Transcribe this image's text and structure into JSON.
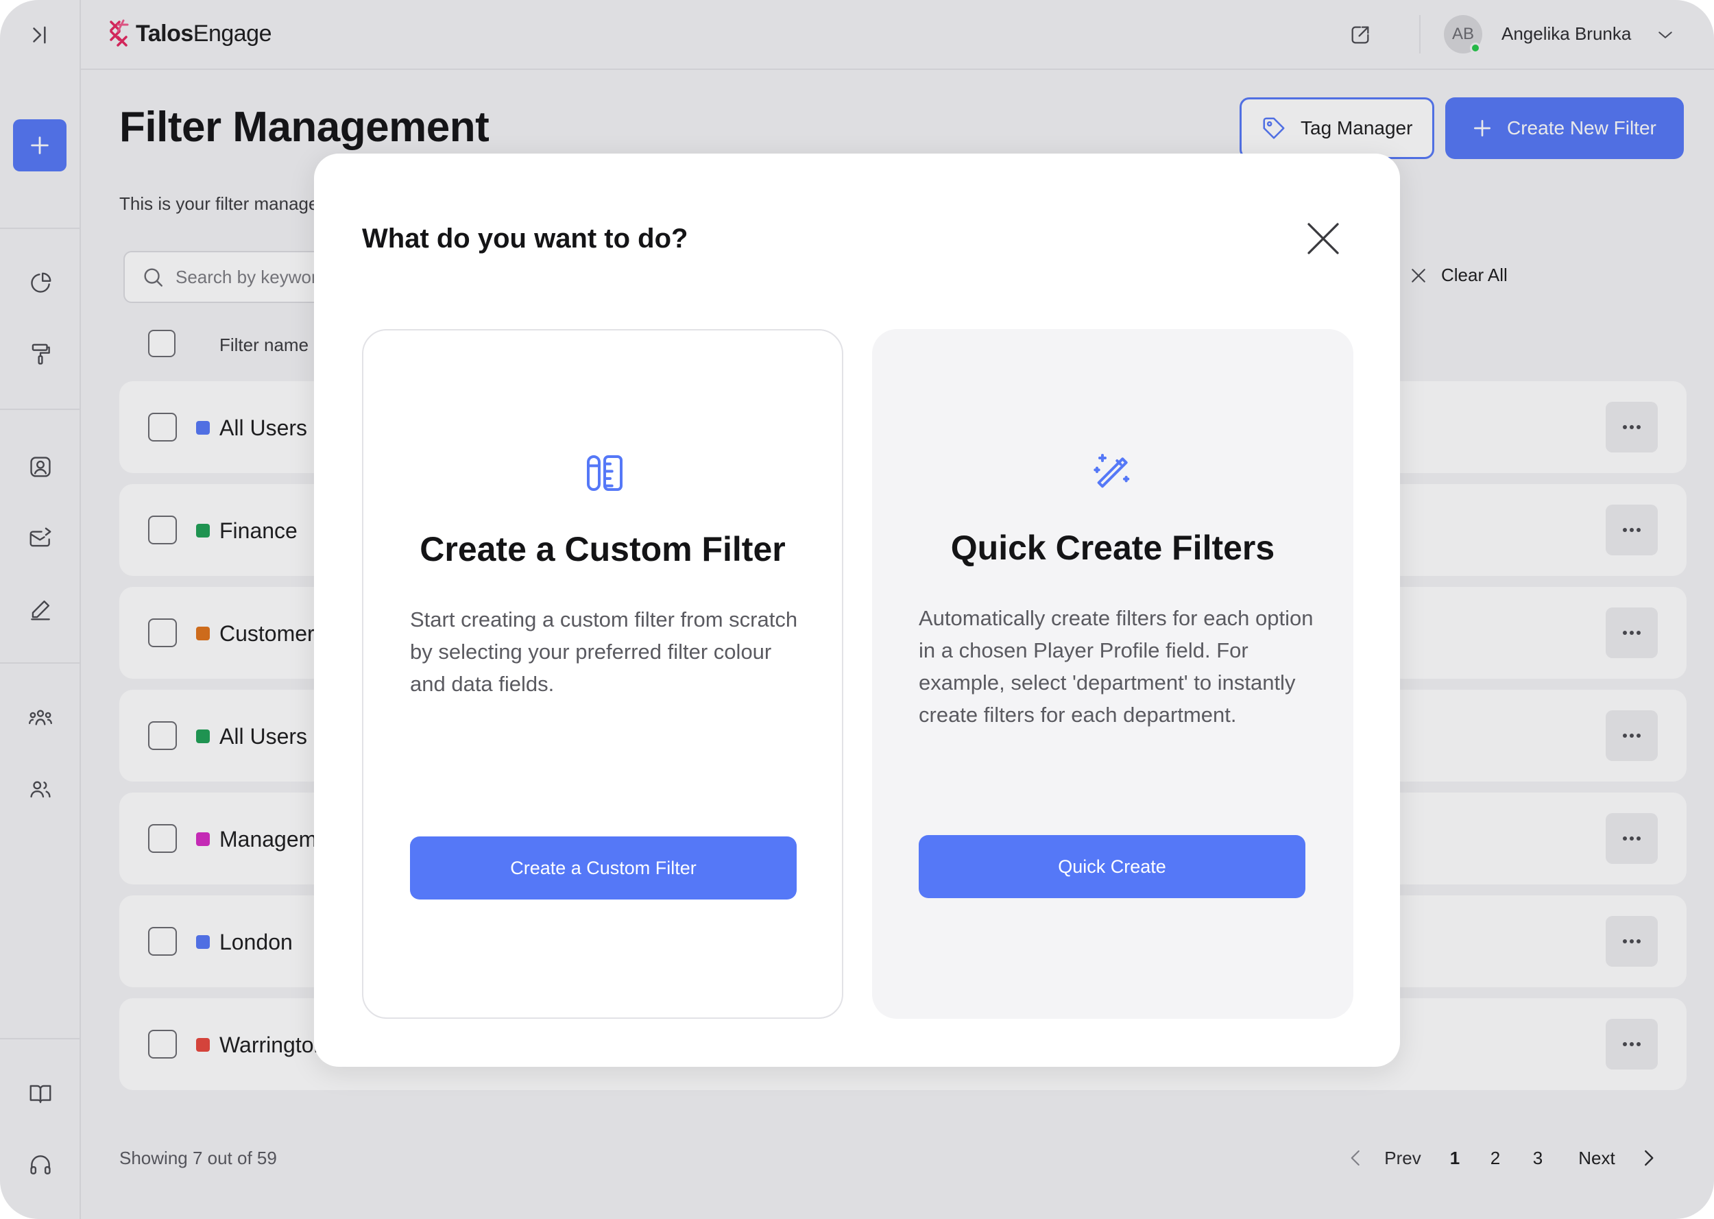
{
  "app": {
    "logo_bold": "Talos",
    "logo_light": "Engage",
    "accent_color": "#5578f7"
  },
  "sidebar": {
    "icons": [
      "expand-sidebar-icon",
      "plus-icon",
      "pie-chart-icon",
      "paint-roller-icon",
      "user-profile-icon",
      "mail-send-icon",
      "pencil-icon",
      "user-group-icon",
      "users-icon",
      "book-icon",
      "headset-icon"
    ]
  },
  "user": {
    "initials": "AB",
    "name": "Angelika Brunka"
  },
  "page": {
    "title": "Filter Management",
    "subtitle": "This is your filter management area",
    "tag_manager_label": "Tag Manager",
    "create_new_label": "Create New Filter",
    "search_placeholder": "Search by keyword",
    "clear_all_label": "Clear All",
    "column_filter_name": "Filter name"
  },
  "filters": [
    {
      "name": "All Users I",
      "color": "#5578f7"
    },
    {
      "name": "Finance",
      "color": "#1fa055"
    },
    {
      "name": "Customer",
      "color": "#e0731a"
    },
    {
      "name": "All Users I",
      "color": "#1fa055"
    },
    {
      "name": "Managem",
      "color": "#d62bc4"
    },
    {
      "name": "London",
      "color": "#5578f7"
    },
    {
      "name": "Warrington",
      "color": "#e8473d"
    }
  ],
  "pagination": {
    "showing": "Showing 7 out of 59",
    "prev": "Prev",
    "pages": [
      "1",
      "2",
      "3"
    ],
    "current": "1",
    "next": "Next"
  },
  "modal": {
    "title": "What do you want to do?",
    "custom": {
      "title": "Create a Custom Filter",
      "description": "Start creating a custom filter from scratch by selecting your preferred filter colour and data fields.",
      "button": "Create a Custom Filter"
    },
    "quick": {
      "title": "Quick Create Filters",
      "description": "Automatically create filters for each option in a chosen Player Profile field. For example, select 'department' to instantly create filters for each department.",
      "button": "Quick Create"
    }
  }
}
